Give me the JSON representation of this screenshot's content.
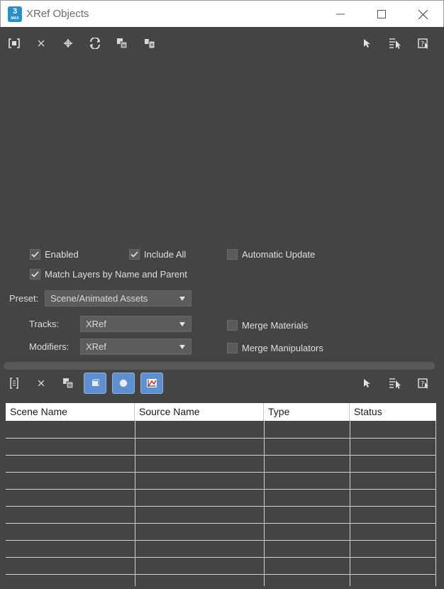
{
  "window": {
    "title": "XRef Objects",
    "app_icon_number": "3",
    "app_icon_caption": "MAX"
  },
  "top_toolbar": {
    "left_icons": [
      "add-xref-icon",
      "remove-icon",
      "add-crosshair-icon",
      "refresh-icon",
      "merge-icon",
      "convert-icon"
    ],
    "right_icons": [
      "select-arrow-icon",
      "select-list-icon",
      "help-icon"
    ]
  },
  "options": {
    "enabled": {
      "label": "Enabled",
      "checked": true
    },
    "include_all": {
      "label": "Include All",
      "checked": true
    },
    "automatic_update": {
      "label": "Automatic Update",
      "checked": false
    },
    "match_layers": {
      "label": "Match Layers by Name and Parent",
      "checked": true
    },
    "merge_materials": {
      "label": "Merge Materials",
      "checked": false
    },
    "merge_manipulators": {
      "label": "Merge Manipulators",
      "checked": false
    }
  },
  "preset": {
    "label": "Preset:",
    "value": "Scene/Animated Assets"
  },
  "tracks": {
    "label": "Tracks:",
    "value": "XRef"
  },
  "modifiers": {
    "label": "Modifiers:",
    "value": "XRef"
  },
  "bottom_toolbar": {
    "left_icons": [
      "add-object-icon",
      "remove-icon",
      "merge-icon"
    ],
    "toggle_icons": [
      "object-cube-icon",
      "sphere-icon",
      "controller-icon"
    ],
    "right_icons": [
      "select-arrow-icon",
      "select-list-icon",
      "help-icon"
    ]
  },
  "table": {
    "columns": [
      "Scene Name",
      "Source Name",
      "Type",
      "Status"
    ],
    "empty_rows": 10
  },
  "colors": {
    "background": "#444444",
    "accent_toggle": "#5f8fcf"
  }
}
